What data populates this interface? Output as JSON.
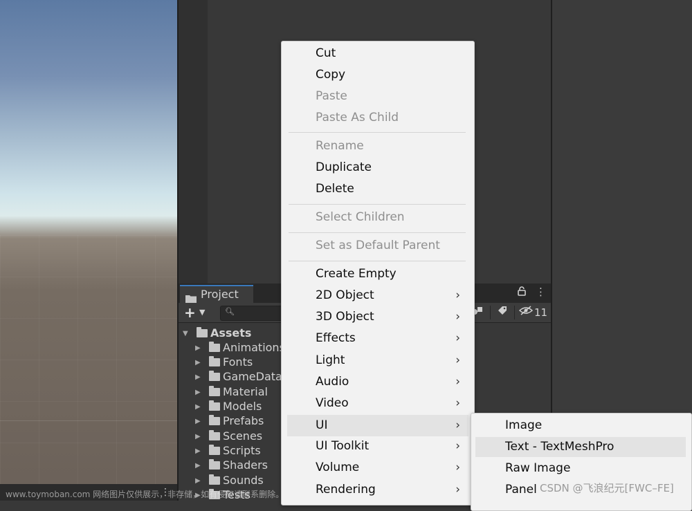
{
  "project": {
    "tab_label": "Project",
    "hidden_count": "11",
    "tree": {
      "root": "Assets",
      "folders": [
        "Animations",
        "Fonts",
        "GameData",
        "Material",
        "Models",
        "Prefabs",
        "Scenes",
        "Scripts",
        "Shaders",
        "Sounds",
        "Tests"
      ]
    }
  },
  "context_menu": {
    "items": [
      {
        "label": "Cut",
        "enabled": true
      },
      {
        "label": "Copy",
        "enabled": true
      },
      {
        "label": "Paste",
        "enabled": false
      },
      {
        "label": "Paste As Child",
        "enabled": false
      },
      {
        "label": "Rename",
        "enabled": false
      },
      {
        "label": "Duplicate",
        "enabled": true
      },
      {
        "label": "Delete",
        "enabled": true
      },
      {
        "label": "Select Children",
        "enabled": false
      },
      {
        "label": "Set as Default Parent",
        "enabled": false
      },
      {
        "label": "Create Empty",
        "enabled": true
      },
      {
        "label": "2D Object",
        "enabled": true,
        "submenu": true
      },
      {
        "label": "3D Object",
        "enabled": true,
        "submenu": true
      },
      {
        "label": "Effects",
        "enabled": true,
        "submenu": true
      },
      {
        "label": "Light",
        "enabled": true,
        "submenu": true
      },
      {
        "label": "Audio",
        "enabled": true,
        "submenu": true
      },
      {
        "label": "Video",
        "enabled": true,
        "submenu": true
      },
      {
        "label": "UI",
        "enabled": true,
        "submenu": true,
        "active": true
      },
      {
        "label": "UI Toolkit",
        "enabled": true,
        "submenu": true
      },
      {
        "label": "Volume",
        "enabled": true,
        "submenu": true
      },
      {
        "label": "Rendering",
        "enabled": true,
        "submenu": true
      }
    ]
  },
  "ui_submenu": {
    "items": [
      {
        "label": "Image"
      },
      {
        "label": "Text - TextMeshPro",
        "hovered": true
      },
      {
        "label": "Raw Image"
      },
      {
        "label": "Panel"
      }
    ]
  },
  "watermarks": {
    "left": "www.toymoban.com 网络图片仅供展示，非存储，如有侵权请联系删除。",
    "right": "CSDN @飞浪纪元[FWC–FE]"
  },
  "icons": {
    "lock": "lock-icon",
    "more": "kebab-menu-icon",
    "submenu_arrow": "chevron-right-icon",
    "folder": "folder-icon",
    "eye": "hidden-eye-icon"
  },
  "colors": {
    "editor_bg": "#383838",
    "menu_bg": "#f2f2f2",
    "menu_highlight": "#e3e3e3",
    "disabled_text": "#8f8f8f",
    "tab_accent": "#3a79bb"
  }
}
